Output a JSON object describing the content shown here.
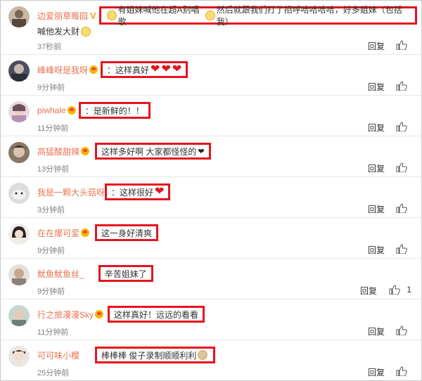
{
  "comments": [
    {
      "user": "边爱丽草莓园",
      "text_line1": "有姐妹喊他在超A别唱歌",
      "text_line1b": "然后就跟我们打了招呼哈哈哈哈，好多姐妹（包括我）",
      "text_line2": "喊他发大财",
      "time": "37秒前",
      "reply": "回复"
    },
    {
      "user": "峰峰呀是我呀",
      "text": "：这样真好",
      "time": "9分钟前",
      "reply": "回复"
    },
    {
      "user": "piwhale",
      "text": "：是新鲜的！！",
      "time": "11分钟前",
      "reply": "回复"
    },
    {
      "user": "高猛酸甜辣",
      "text": "这样多好啊 大家都怪怪的",
      "time": "13分钟前",
      "reply": "回复"
    },
    {
      "user": "我是一颗大头菇呀",
      "text": "：这样很好",
      "time": "3分钟前",
      "reply": "回复"
    },
    {
      "user": "在在爆可爱",
      "text": "这一身好清爽",
      "time": "9分钟前",
      "reply": "回复"
    },
    {
      "user": "鱿鱼鱿鱼丝_",
      "text": "辛苦姐妹了",
      "time": "9分钟前",
      "reply": "回复",
      "like_count": "1"
    },
    {
      "user": "行之旅漫漫Sky",
      "text": "这样真好！远远的看看",
      "time": "11分钟前",
      "reply": "回复"
    },
    {
      "user": "可可味小樱",
      "text": "棒棒棒 俊子录制顺顺利利",
      "time": "25分钟前",
      "reply": "回复"
    }
  ],
  "colors": {
    "highlight": "#e6141e",
    "username": "#eb7350",
    "time": "#808080"
  }
}
